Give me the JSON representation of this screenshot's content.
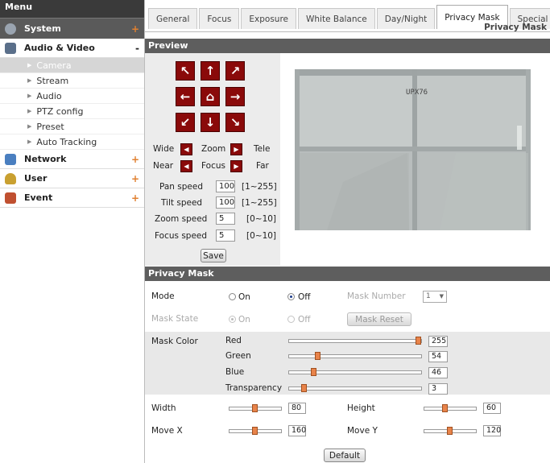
{
  "sidebar": {
    "menu_title": "Menu",
    "system": {
      "label": "System",
      "sign": "+"
    },
    "audio_video": {
      "label": "Audio & Video",
      "sign": "-"
    },
    "sub_items": [
      "Camera",
      "Stream",
      "Audio",
      "PTZ config",
      "Preset",
      "Auto Tracking"
    ],
    "active_sub": "Camera",
    "network": {
      "label": "Network",
      "sign": "+"
    },
    "user": {
      "label": "User",
      "sign": "+"
    },
    "event": {
      "label": "Event",
      "sign": "+"
    }
  },
  "tabs": [
    "General",
    "Focus",
    "Exposure",
    "White Balance",
    "Day/Night",
    "Privacy Mask",
    "Special"
  ],
  "active_tab": "Privacy Mask",
  "breadcrumb": "Privacy Mask",
  "preview": {
    "title": "Preview",
    "zoom": {
      "left": "Wide",
      "center": "Zoom",
      "right": "Tele"
    },
    "focus": {
      "left": "Near",
      "center": "Focus",
      "right": "Far"
    },
    "speeds": [
      {
        "label": "Pan speed",
        "value": "100",
        "range": "[1~255]"
      },
      {
        "label": "Tilt speed",
        "value": "100",
        "range": "[1~255]"
      },
      {
        "label": "Zoom speed",
        "value": "5",
        "range": "[0~10]"
      },
      {
        "label": "Focus speed",
        "value": "5",
        "range": "[0~10]"
      }
    ],
    "save_label": "Save",
    "camera_text": "UPX76"
  },
  "privacy": {
    "title": "Privacy Mask",
    "mode_label": "Mode",
    "on_label": "On",
    "off_label": "Off",
    "mode_value": "Off",
    "mask_number_label": "Mask Number",
    "mask_number_value": "1",
    "mask_state_label": "Mask State",
    "mask_state_value": "On",
    "mask_reset_label": "Mask Reset",
    "mask_color_label": "Mask Color",
    "colors": [
      {
        "label": "Red",
        "value": "255",
        "fraction": 1.0
      },
      {
        "label": "Green",
        "value": "54",
        "fraction": 0.21
      },
      {
        "label": "Blue",
        "value": "46",
        "fraction": 0.18
      },
      {
        "label": "Transparency",
        "value": "3",
        "fraction": 0.1
      }
    ],
    "width": {
      "label": "Width",
      "value": "80",
      "fraction": 0.5
    },
    "height": {
      "label": "Height",
      "value": "60",
      "fraction": 0.4
    },
    "move_x": {
      "label": "Move X",
      "value": "160",
      "fraction": 0.5
    },
    "move_y": {
      "label": "Move Y",
      "value": "120",
      "fraction": 0.5
    },
    "default_label": "Default"
  },
  "colors": {
    "accent_red": "#8a0a0a",
    "slider_knob": "#e8834a",
    "section_bar": "#5e5e5e"
  }
}
